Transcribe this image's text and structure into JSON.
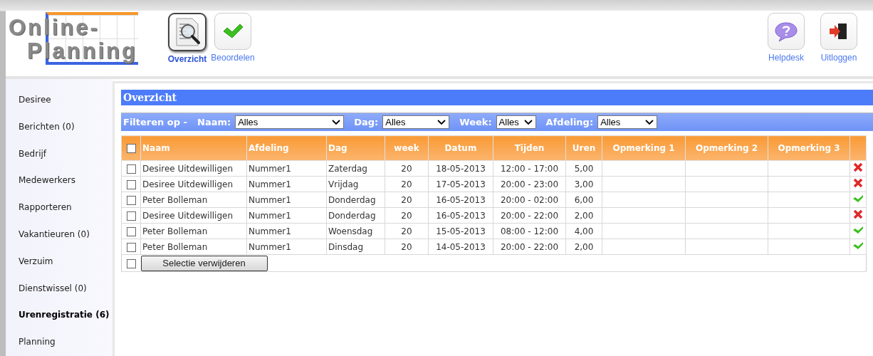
{
  "logo": {
    "lines": [
      "Online-",
      "Planning"
    ]
  },
  "nav": [
    {
      "label": "Overzicht",
      "selected": true
    },
    {
      "label": "Beoordelen",
      "selected": false
    }
  ],
  "nav_right": [
    {
      "label": "Helpdesk"
    },
    {
      "label": "Uitloggen"
    }
  ],
  "sidebar": {
    "items": [
      {
        "label": "Desiree",
        "selected": false
      },
      {
        "label": "Berichten (0)",
        "selected": false
      },
      {
        "label": "Bedrijf",
        "selected": false
      },
      {
        "label": "Medewerkers",
        "selected": false
      },
      {
        "label": "Rapporteren",
        "selected": false
      },
      {
        "label": "Vakantieuren (0)",
        "selected": false
      },
      {
        "label": "Verzuim",
        "selected": false
      },
      {
        "label": "Dienstwissel (0)",
        "selected": false
      },
      {
        "label": "Urenregistratie (6)",
        "selected": true
      },
      {
        "label": "Planning",
        "selected": false
      }
    ]
  },
  "panel": {
    "title": "Overzicht"
  },
  "filter": {
    "label": "Filteren op -",
    "fields": [
      {
        "label": "Naam:",
        "value": "Alles"
      },
      {
        "label": "Dag:",
        "value": "Alles"
      },
      {
        "label": "Week:",
        "value": "Alles"
      },
      {
        "label": "Afdeling:",
        "value": "Alles"
      }
    ]
  },
  "table": {
    "header_checked": false,
    "columns": [
      "Naam",
      "Afdeling",
      "Dag",
      "week",
      "Datum",
      "Tijden",
      "Uren",
      "Opmerking 1",
      "Opmerking 2",
      "Opmerking 3"
    ],
    "rows": [
      {
        "checked": false,
        "cells": [
          "Desiree Uitdewilligen",
          "Nummer1",
          "Zaterdag",
          "20",
          "18-05-2013",
          "12:00 - 17:00",
          "5,00"
        ],
        "approved": false
      },
      {
        "checked": false,
        "cells": [
          "Desiree Uitdewilligen",
          "Nummer1",
          "Vrijdag",
          "20",
          "17-05-2013",
          "20:00 - 23:00",
          "3,00"
        ],
        "approved": false
      },
      {
        "checked": false,
        "cells": [
          "Peter Bolleman",
          "Nummer1",
          "Donderdag",
          "20",
          "16-05-2013",
          "20:00 - 02:00",
          "6,00"
        ],
        "approved": true
      },
      {
        "checked": false,
        "cells": [
          "Desiree Uitdewilligen",
          "Nummer1",
          "Donderdag",
          "20",
          "16-05-2013",
          "20:00 - 22:00",
          "2,00"
        ],
        "approved": false
      },
      {
        "checked": false,
        "cells": [
          "Peter Bolleman",
          "Nummer1",
          "Woensdag",
          "20",
          "15-05-2013",
          "08:00 - 12:00",
          "4,00"
        ],
        "approved": true
      },
      {
        "checked": false,
        "cells": [
          "Peter Bolleman",
          "Nummer1",
          "Dinsdag",
          "20",
          "14-05-2013",
          "20:00 - 22:00",
          "2,00"
        ],
        "approved": true
      }
    ],
    "footer_checked": false,
    "delete_button": "Selectie verwijderen"
  }
}
